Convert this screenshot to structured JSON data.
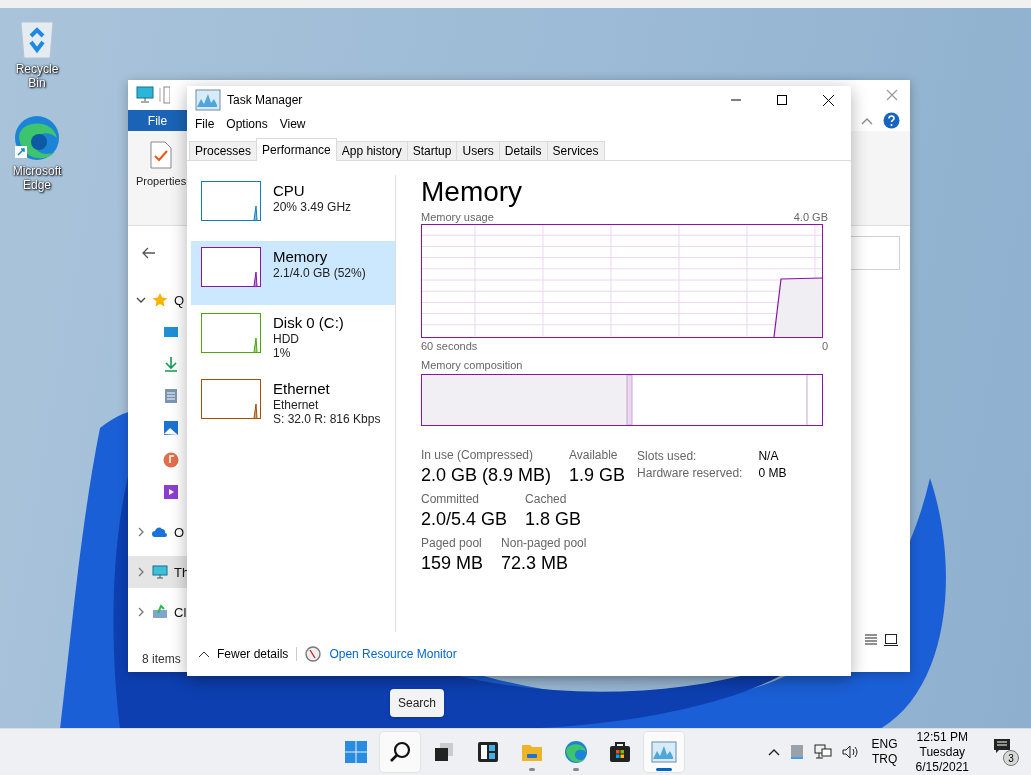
{
  "desktop_icons": [
    {
      "kind": "recycle",
      "label": "Recycle Bin"
    },
    {
      "kind": "edge",
      "label": "Microsoft Edge"
    }
  ],
  "explorer": {
    "ribbon_tab": "File",
    "ribbon_button": "Properties",
    "nav_items": [
      {
        "kind": "star",
        "label": "Q",
        "expanded": true,
        "selected": false,
        "children": [
          {
            "kind": "desktop"
          },
          {
            "kind": "download"
          },
          {
            "kind": "document"
          },
          {
            "kind": "picture"
          },
          {
            "kind": "music"
          },
          {
            "kind": "video"
          }
        ]
      },
      {
        "kind": "cloud",
        "label": "O",
        "expanded": false,
        "selected": false
      },
      {
        "kind": "pc",
        "label": "Th",
        "expanded": false,
        "selected": true
      },
      {
        "kind": "network",
        "label": "Cl",
        "expanded": false,
        "selected": false
      }
    ],
    "status": "8 items"
  },
  "task_manager": {
    "title": "Task Manager",
    "menu": [
      "File",
      "Options",
      "View"
    ],
    "tabs": [
      {
        "label": "Processes",
        "selected": false
      },
      {
        "label": "Performance",
        "selected": true
      },
      {
        "label": "App history",
        "selected": false
      },
      {
        "label": "Startup",
        "selected": false
      },
      {
        "label": "Users",
        "selected": false
      },
      {
        "label": "Details",
        "selected": false
      },
      {
        "label": "Services",
        "selected": false
      }
    ],
    "resources": [
      {
        "name": "CPU",
        "lines": [
          "20%  3.49 GHz"
        ],
        "color": "#117dbb",
        "selected": false
      },
      {
        "name": "Memory",
        "lines": [
          "2.1/4.0 GB (52%)"
        ],
        "color": "#8b12ae",
        "selected": true
      },
      {
        "name": "Disk 0 (C:)",
        "lines": [
          "HDD",
          "1%"
        ],
        "color": "#4da60c",
        "selected": false
      },
      {
        "name": "Ethernet",
        "lines": [
          "Ethernet",
          "S: 32.0 R: 816 Kbps"
        ],
        "color": "#a74f01",
        "selected": false
      }
    ],
    "detail": {
      "title": "Memory",
      "graph_label": "Memory usage",
      "graph_max": "4.0 GB",
      "graph_span": "60 seconds",
      "graph_min": "0",
      "composition_label": "Memory composition",
      "stats": [
        [
          {
            "label": "In use (Compressed)",
            "value": "2.0 GB (8.9 MB)"
          },
          {
            "label": "Available",
            "value": "1.9 GB"
          }
        ],
        [
          {
            "label": "Committed",
            "value": "2.0/5.4 GB"
          },
          {
            "label": "Cached",
            "value": "1.8 GB"
          }
        ],
        [
          {
            "label": "Paged pool",
            "value": "159 MB"
          },
          {
            "label": "Non-paged pool",
            "value": "72.3 MB"
          }
        ]
      ],
      "side_stats": [
        {
          "label": "Slots used:",
          "value": "N/A"
        },
        {
          "label": "Hardware reserved:",
          "value": "0 MB"
        }
      ]
    },
    "footer": {
      "toggle": "Fewer details",
      "link": "Open Resource Monitor"
    }
  },
  "taskbar": {
    "apps": [
      {
        "kind": "start",
        "running": false,
        "active": false,
        "highlighted": false
      },
      {
        "kind": "search",
        "running": false,
        "active": false,
        "highlighted": true
      },
      {
        "kind": "taskview",
        "running": false,
        "active": false,
        "highlighted": false
      },
      {
        "kind": "widgets",
        "running": false,
        "active": false,
        "highlighted": false
      },
      {
        "kind": "folder",
        "running": true,
        "active": false,
        "highlighted": false
      },
      {
        "kind": "edge",
        "running": true,
        "active": false,
        "highlighted": false
      },
      {
        "kind": "store",
        "running": false,
        "active": false,
        "highlighted": false
      },
      {
        "kind": "taskmgr",
        "running": true,
        "active": true,
        "highlighted": false
      }
    ],
    "tooltip": "Search",
    "language": [
      "ENG",
      "TRQ"
    ],
    "time": "12:51 PM",
    "day": "Tuesday",
    "date": "6/15/2021",
    "notifications": "3"
  }
}
